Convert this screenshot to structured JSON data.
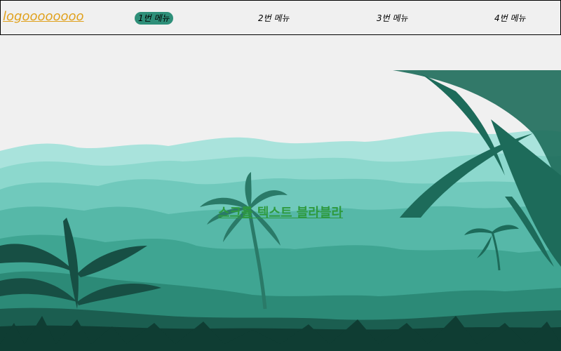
{
  "header": {
    "logo": "logoooooooo",
    "menu": [
      {
        "label": "1번 메뉴",
        "active": true
      },
      {
        "label": "2번 메뉴",
        "active": false
      },
      {
        "label": "3번 메뉴",
        "active": false
      },
      {
        "label": "4번 메뉴",
        "active": false
      }
    ]
  },
  "hero": {
    "text": "스크롤 텍스트 블라블라"
  },
  "colors": {
    "logo": "#e0a11d",
    "active_menu_bg": "#2e8f79",
    "hero_text": "#2e9a3e"
  },
  "icons": {
    "hero_image": "jungle-landscape"
  }
}
